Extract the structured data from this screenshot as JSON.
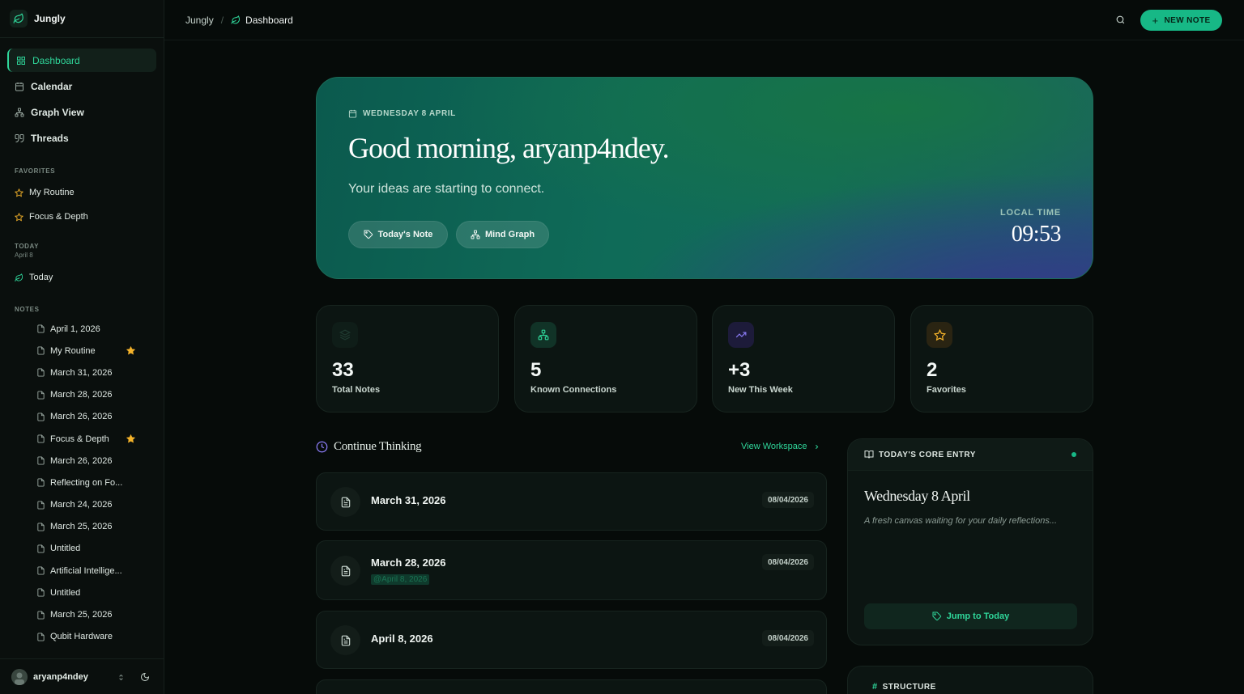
{
  "app": {
    "name": "Jungly"
  },
  "sidebar": {
    "nav": [
      {
        "label": "Dashboard",
        "icon": "dashboard-icon",
        "active": true
      },
      {
        "label": "Calendar",
        "icon": "calendar-icon"
      },
      {
        "label": "Graph View",
        "icon": "graph-icon"
      },
      {
        "label": "Threads",
        "icon": "quote-icon"
      }
    ],
    "favorites_label": "FAVORITES",
    "favorites": [
      {
        "label": "My Routine"
      },
      {
        "label": "Focus & Depth"
      }
    ],
    "today_label": "TODAY",
    "today_date": "April 8",
    "today_item": "Today",
    "notes_label": "NOTES",
    "notes": [
      {
        "label": "April 1, 2026",
        "starred": false
      },
      {
        "label": "My Routine",
        "starred": true
      },
      {
        "label": "March 31, 2026",
        "starred": false
      },
      {
        "label": "March 28, 2026",
        "starred": false
      },
      {
        "label": "March 26, 2026",
        "starred": false
      },
      {
        "label": "Focus & Depth",
        "starred": true
      },
      {
        "label": "March 26, 2026",
        "starred": false
      },
      {
        "label": "Reflecting on Fo...",
        "starred": false
      },
      {
        "label": "March 24, 2026",
        "starred": false
      },
      {
        "label": "March 25, 2026",
        "starred": false
      },
      {
        "label": "Untitled",
        "starred": false
      },
      {
        "label": "Artificial Intellige...",
        "starred": false
      },
      {
        "label": "Untitled",
        "starred": false
      },
      {
        "label": "March 25, 2026",
        "starred": false
      },
      {
        "label": "Qubit Hardware",
        "starred": false
      }
    ],
    "user": {
      "name": "aryanp4ndey"
    }
  },
  "topbar": {
    "breadcrumb": [
      "Jungly",
      "Dashboard"
    ],
    "new_note_label": "NEW NOTE"
  },
  "hero": {
    "date": "WEDNESDAY 8 APRIL",
    "greeting": "Good morning, aryanp4ndey.",
    "subtitle": "Your ideas are starting to connect.",
    "buttons": [
      "Today's Note",
      "Mind Graph"
    ],
    "local_time_label": "LOCAL TIME",
    "local_time": "09:53"
  },
  "stats": [
    {
      "value": "33",
      "label": "Total Notes",
      "icon": "layers-icon",
      "color": "#1f3a30"
    },
    {
      "value": "5",
      "label": "Known Connections",
      "icon": "network-icon",
      "color": "#2fd69a"
    },
    {
      "value": "+3",
      "label": "New This Week",
      "icon": "trending-up-icon",
      "color": "#8b7cf6"
    },
    {
      "value": "2",
      "label": "Favorites",
      "icon": "star-icon",
      "color": "#f5b32a"
    }
  ],
  "continue_thinking": {
    "title": "Continue Thinking",
    "view_link": "View Workspace",
    "items": [
      {
        "title": "March 31, 2026",
        "date": "08/04/2026",
        "tag": ""
      },
      {
        "title": "March 28, 2026",
        "date": "08/04/2026",
        "tag": "@April 8, 2026"
      },
      {
        "title": "April 8, 2026",
        "date": "08/04/2026",
        "tag": ""
      }
    ]
  },
  "core_entry": {
    "header": "TODAY'S CORE ENTRY",
    "title": "Wednesday 8 April",
    "description": "A fresh canvas waiting for your daily reflections...",
    "button": "Jump to Today"
  },
  "structure": {
    "label": "STRUCTURE"
  },
  "colors": {
    "accent": "#17b886",
    "accent_text": "#2fd69a",
    "star": "#f5b32a"
  }
}
